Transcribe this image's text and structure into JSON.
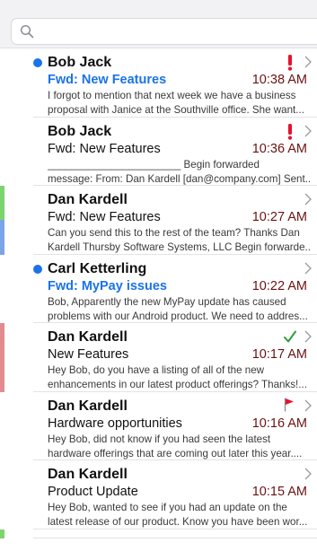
{
  "search": {
    "placeholder": "",
    "value": ""
  },
  "colors": {
    "accent": "#1a73e8",
    "time": "#6b1212",
    "flag_red": "#e8112d",
    "check_green": "#2e9e3a"
  },
  "messages": [
    {
      "sender": "Bob Jack",
      "subject": "Fwd: New Features",
      "time": "10:38 AM",
      "preview": [
        "I forgot to mention that next week we have a business",
        "proposal with Janice at the Southville office. She want..."
      ],
      "unread": true,
      "status_icon": "exclamation-icon",
      "tags": []
    },
    {
      "sender": "Bob Jack",
      "subject": "Fwd: New Features",
      "time": "10:36 AM",
      "preview": [
        "_______________________ Begin forwarded",
        "message: From: Dan Kardell [dan@company.com] Sent..."
      ],
      "unread": false,
      "status_icon": "exclamation-icon",
      "tags": []
    },
    {
      "sender": "Dan Kardell",
      "subject": "Fwd: New Features",
      "time": "10:27 AM",
      "preview": [
        "Can you send this to the rest of the team? Thanks Dan",
        "Kardell Thursby Software Systems, LLC Begin forwarde..."
      ],
      "unread": false,
      "status_icon": "",
      "tags": [
        "#7cd46e",
        "#7ba4e9"
      ]
    },
    {
      "sender": "Carl Ketterling",
      "subject": "Fwd: MyPay issues",
      "time": "10:22 AM",
      "preview": [
        "Bob, Apparently the new MyPay update has caused",
        "problems with our Android product. We need to addres..."
      ],
      "unread": true,
      "status_icon": "",
      "tags": []
    },
    {
      "sender": "Dan Kardell",
      "subject": "New Features",
      "time": "10:17 AM",
      "preview": [
        "Hey Bob, do you have a listing of all of the new",
        "enhancements in our latest product offerings? Thanks!..."
      ],
      "unread": false,
      "status_icon": "checkmark-icon",
      "tags": [
        "#e38c8f"
      ]
    },
    {
      "sender": "Dan Kardell",
      "subject": "Hardware opportunities",
      "time": "10:16 AM",
      "preview": [
        "Hey Bob, did not know if you had seen the latest",
        "hardware offerings that are coming out later this year...."
      ],
      "unread": false,
      "status_icon": "flag-icon",
      "tags": []
    },
    {
      "sender": "Dan Kardell",
      "subject": "Product Update",
      "time": "10:15 AM",
      "preview": [
        "Hey Bob, wanted to see if you had an update on the",
        "latest release of our product. Know you have been wor..."
      ],
      "unread": false,
      "status_icon": "",
      "tags": []
    },
    {
      "sender": "",
      "subject": "",
      "time": "",
      "preview": [],
      "unread": false,
      "status_icon": "",
      "tags": [
        "#7cd46e"
      ]
    }
  ]
}
